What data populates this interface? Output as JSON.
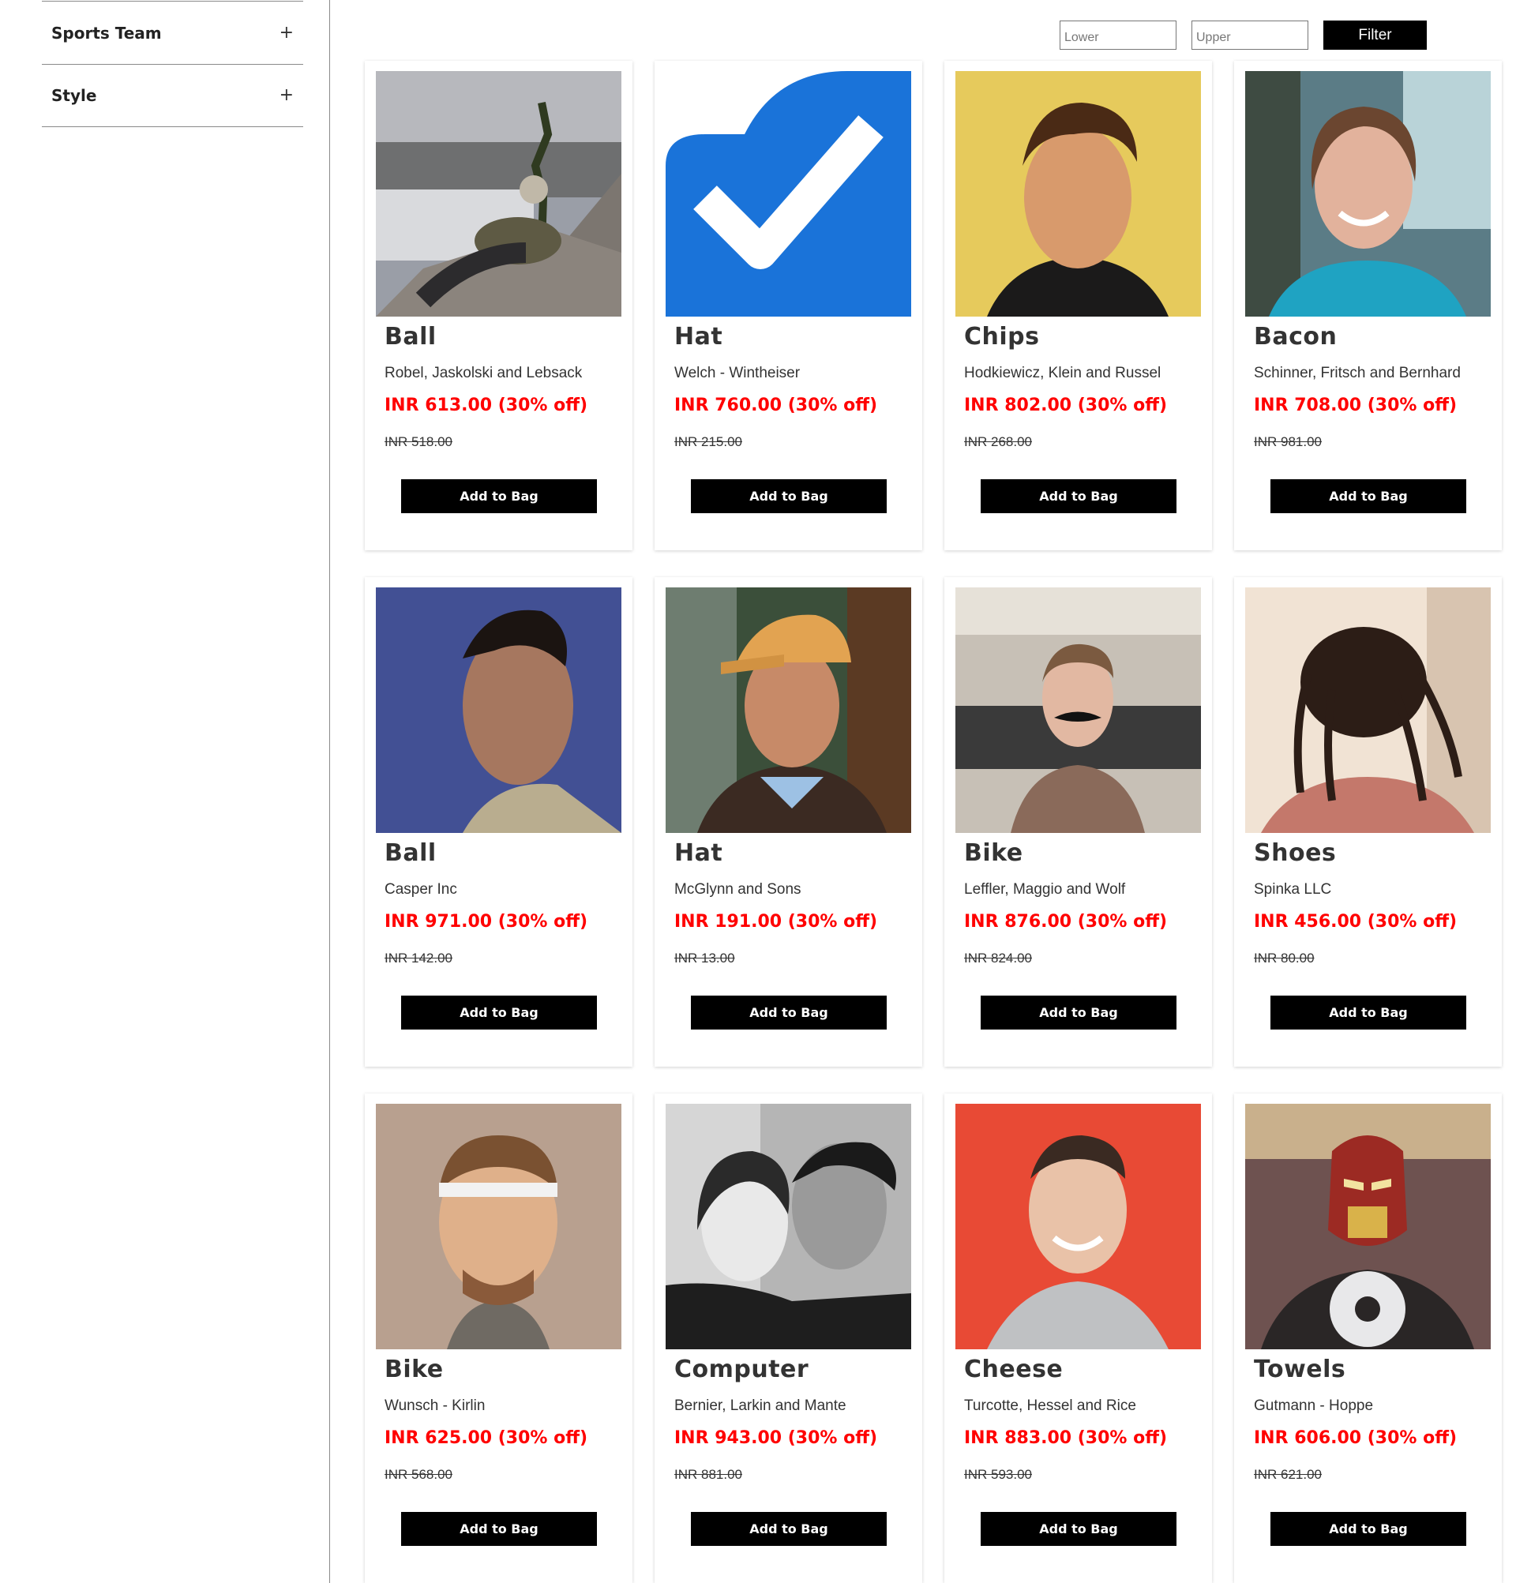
{
  "sidebar": {
    "filters": [
      {
        "label": "Sports Team",
        "toggle": "+"
      },
      {
        "label": "Style",
        "toggle": "+"
      }
    ]
  },
  "price_filter": {
    "lower_placeholder": "Lower",
    "upper_placeholder": "Upper",
    "button_label": "Filter"
  },
  "products": [
    {
      "name": "Ball",
      "brand": "Robel, Jaskolski and Lebsack",
      "price": "INR 613.00 (30% off)",
      "old_price": "INR 518.00",
      "button": "Add to Bag",
      "image": "person-on-rocks-photo"
    },
    {
      "name": "Hat",
      "brand": "Welch - Wintheiser",
      "price": "INR 760.00 (30% off)",
      "old_price": "INR 215.00",
      "button": "Add to Bag",
      "image": "blue-cloud-checkmark-logo"
    },
    {
      "name": "Chips",
      "brand": "Hodkiewicz, Klein and Russel",
      "price": "INR 802.00 (30% off)",
      "old_price": "INR 268.00",
      "button": "Add to Bag",
      "image": "man-portrait-photo"
    },
    {
      "name": "Bacon",
      "brand": "Schinner, Fritsch and Bernhard",
      "price": "INR 708.00 (30% off)",
      "old_price": "INR 981.00",
      "button": "Add to Bag",
      "image": "woman-smiling-photo"
    },
    {
      "name": "Ball",
      "brand": "Casper Inc",
      "price": "INR 971.00 (30% off)",
      "old_price": "INR 142.00",
      "button": "Add to Bag",
      "image": "man-profile-blue-photo"
    },
    {
      "name": "Hat",
      "brand": "McGlynn and Sons",
      "price": "INR 191.00 (30% off)",
      "old_price": "INR 13.00",
      "button": "Add to Bag",
      "image": "man-orange-cap-photo"
    },
    {
      "name": "Bike",
      "brand": "Leffler, Maggio and Wolf",
      "price": "INR 876.00 (30% off)",
      "old_price": "INR 824.00",
      "button": "Add to Bag",
      "image": "man-mustache-office-photo"
    },
    {
      "name": "Shoes",
      "brand": "Spinka LLC",
      "price": "INR 456.00 (30% off)",
      "old_price": "INR 80.00",
      "button": "Add to Bag",
      "image": "dreadlocks-photo"
    },
    {
      "name": "Bike",
      "brand": "Wunsch - Kirlin",
      "price": "INR 625.00 (30% off)",
      "old_price": "INR 568.00",
      "button": "Add to Bag",
      "image": "bobblehead-photo"
    },
    {
      "name": "Computer",
      "brand": "Bernier, Larkin and Mante",
      "price": "INR 943.00 (30% off)",
      "old_price": "INR 881.00",
      "button": "Add to Bag",
      "image": "couple-bw-photo"
    },
    {
      "name": "Cheese",
      "brand": "Turcotte, Hessel and Rice",
      "price": "INR 883.00 (30% off)",
      "old_price": "INR 593.00",
      "button": "Add to Bag",
      "image": "man-red-background-photo"
    },
    {
      "name": "Towels",
      "brand": "Gutmann - Hoppe",
      "price": "INR 606.00 (30% off)",
      "old_price": "INR 621.00",
      "button": "Add to Bag",
      "image": "iron-man-mask-photo"
    }
  ]
}
